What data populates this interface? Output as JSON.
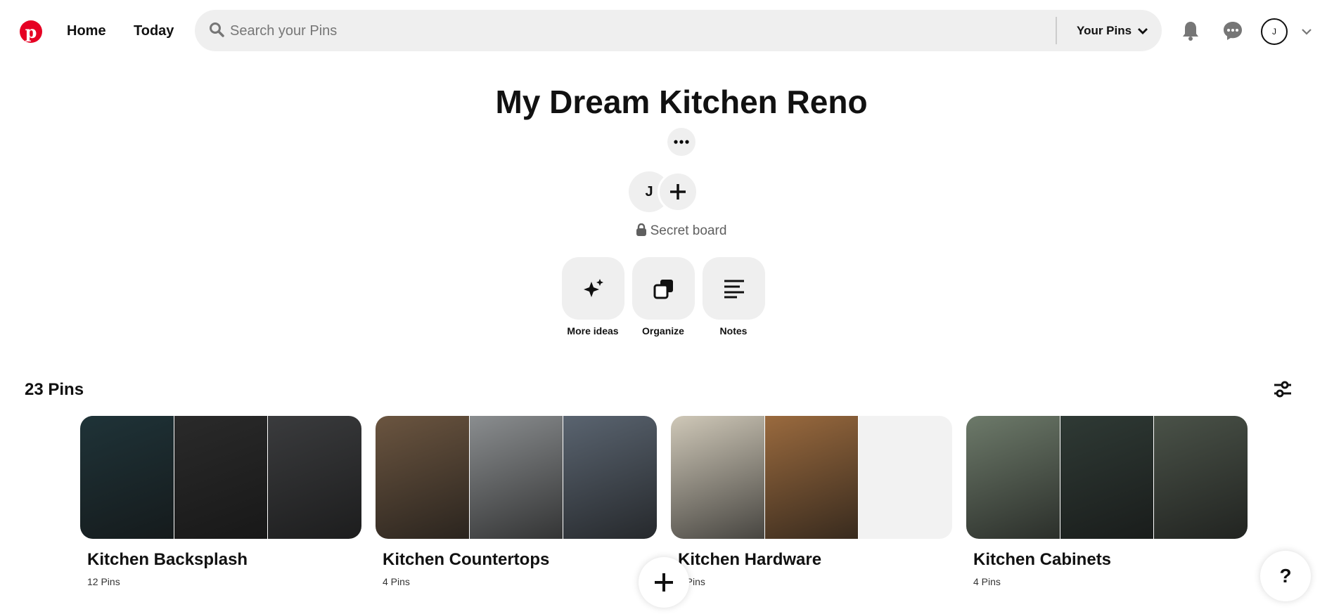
{
  "header": {
    "logo": "Pinterest",
    "nav": [
      {
        "label": "Home"
      },
      {
        "label": "Today"
      }
    ],
    "search": {
      "placeholder": "Search your Pins",
      "scope": "Your Pins"
    },
    "avatar_initial": "J"
  },
  "board": {
    "title": "My Dream Kitchen Reno",
    "collaborator_initial": "J",
    "privacy": "Secret board",
    "actions": [
      {
        "label": "More ideas",
        "icon": "sparkle-icon"
      },
      {
        "label": "Organize",
        "icon": "organize-icon"
      },
      {
        "label": "Notes",
        "icon": "notes-icon"
      }
    ],
    "pin_count": "23 Pins"
  },
  "sections": [
    {
      "title": "Kitchen Backsplash",
      "count": "12 Pins",
      "images": [
        "#1f3338",
        "#2a2a2a",
        "#3a3b3d"
      ]
    },
    {
      "title": "Kitchen Countertops",
      "count": "4 Pins",
      "images": [
        "#6b5540",
        "#8a8d8f",
        "#5a6470"
      ]
    },
    {
      "title": "Kitchen Hardware",
      "count": "4 Pins",
      "images": [
        "#cfc8b8",
        "#9a6a3e",
        "#f2f2f2"
      ]
    },
    {
      "title": "Kitchen Cabinets",
      "count": "4 Pins",
      "images": [
        "#6d7a6a",
        "#2f3a35",
        "#4a5248"
      ]
    }
  ],
  "help_label": "?",
  "colors": {
    "brand": "#e60023",
    "surface": "#efefef"
  }
}
